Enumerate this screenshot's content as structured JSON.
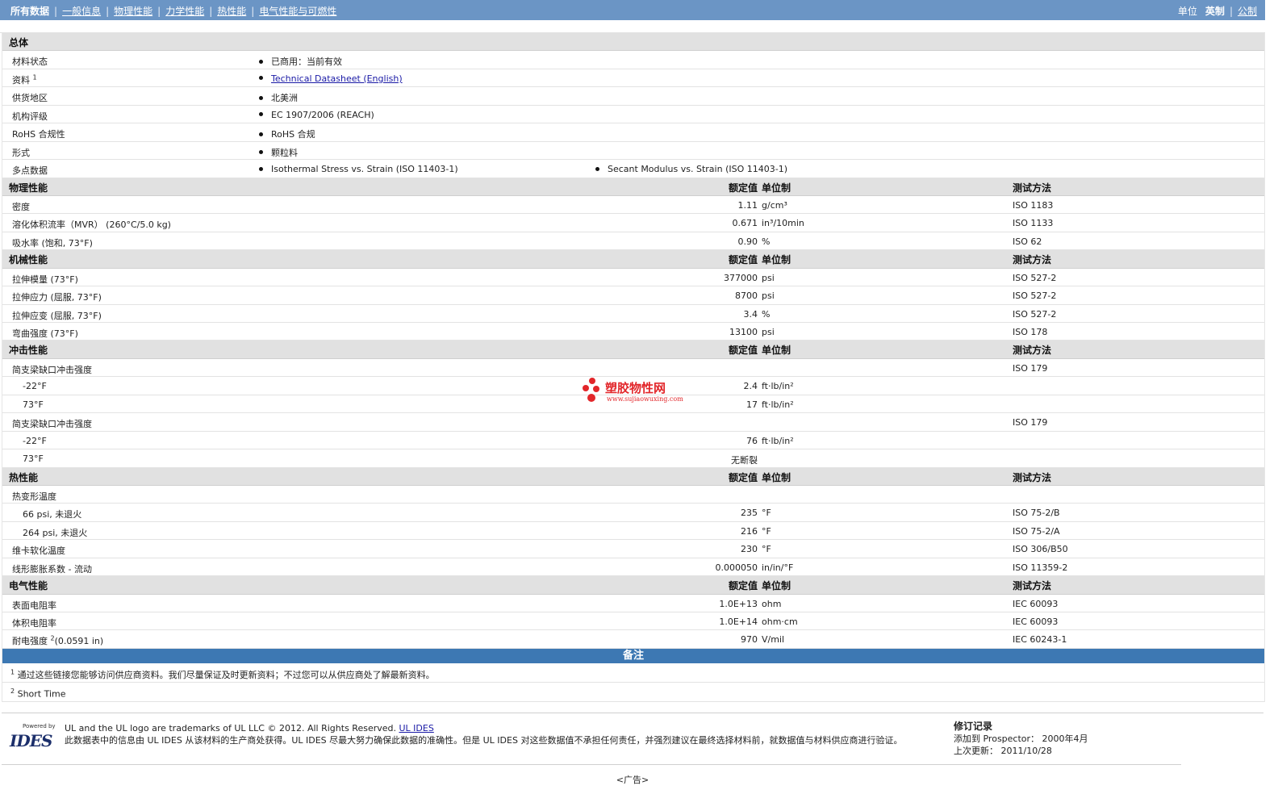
{
  "nav": {
    "items": [
      "所有数据",
      "一般信息",
      "物理性能",
      "力学性能",
      "热性能",
      "电气性能与可燃性"
    ],
    "unit_label": "单位",
    "unit_english": "英制",
    "unit_metric": "公制"
  },
  "general": {
    "title": "总体",
    "rows": [
      {
        "label": "材料状态",
        "values": [
          "已商用：当前有效"
        ]
      },
      {
        "label": "资料",
        "sup": "1",
        "values": [
          "Technical Datasheet (English)"
        ]
      },
      {
        "label": "供货地区",
        "values": [
          "北美洲"
        ]
      },
      {
        "label": "机构评级",
        "values": [
          "EC 1907/2006 (REACH)"
        ]
      },
      {
        "label": "RoHS 合规性",
        "values": [
          "RoHS 合规"
        ]
      },
      {
        "label": "形式",
        "values": [
          "颗粒料"
        ]
      },
      {
        "label": "多点数据",
        "values": [
          "Isothermal Stress vs. Strain (ISO 11403-1)",
          "Secant Modulus vs. Strain (ISO 11403-1)"
        ]
      }
    ]
  },
  "headers": {
    "value": "额定值",
    "unit": "单位制",
    "method": "测试方法"
  },
  "physical": {
    "title": "物理性能",
    "rows": [
      {
        "label": "密度",
        "value": "1.11",
        "unit": "g/cm³",
        "method": "ISO 1183"
      },
      {
        "label": "溶化体积流率（MVR） (260°C/5.0 kg)",
        "value": "0.671",
        "unit": "in³/10min",
        "method": "ISO 1133"
      },
      {
        "label": "吸水率 (饱和, 73°F)",
        "value": "0.90",
        "unit": "%",
        "method": "ISO 62"
      }
    ]
  },
  "mechanical": {
    "title": "机械性能",
    "rows": [
      {
        "label": "拉伸模量 (73°F)",
        "value": "377000",
        "unit": "psi",
        "method": "ISO 527-2"
      },
      {
        "label": "拉伸应力 (屈服, 73°F)",
        "value": "8700",
        "unit": "psi",
        "method": "ISO 527-2"
      },
      {
        "label": "拉伸应变 (屈服, 73°F)",
        "value": "3.4",
        "unit": "%",
        "method": "ISO 527-2"
      },
      {
        "label": "弯曲强度 (73°F)",
        "value": "13100",
        "unit": "psi",
        "method": "ISO 178"
      }
    ]
  },
  "impact": {
    "title": "冲击性能",
    "rows": [
      {
        "label": "简支梁缺口冲击强度",
        "value": "",
        "unit": "",
        "method": "ISO 179"
      },
      {
        "label": "-22°F",
        "value": "2.4",
        "unit": "ft·lb/in²",
        "method": ""
      },
      {
        "label": "73°F",
        "value": "17",
        "unit": "ft·lb/in²",
        "method": ""
      },
      {
        "label": "简支梁缺口冲击强度",
        "value": "",
        "unit": "",
        "method": "ISO 179"
      },
      {
        "label": "-22°F",
        "value": "76",
        "unit": "ft·lb/in²",
        "method": ""
      },
      {
        "label": "73°F",
        "value": "无断裂",
        "unit": "",
        "method": ""
      }
    ]
  },
  "thermal": {
    "title": "热性能",
    "rows": [
      {
        "label": "热变形温度",
        "value": "",
        "unit": "",
        "method": ""
      },
      {
        "label": "66 psi, 未退火",
        "value": "235",
        "unit": "°F",
        "method": "ISO 75-2/B"
      },
      {
        "label": "264 psi, 未退火",
        "value": "216",
        "unit": "°F",
        "method": "ISO 75-2/A"
      },
      {
        "label": "维卡软化温度",
        "value": "230",
        "unit": "°F",
        "method": "ISO 306/B50"
      },
      {
        "label": "线形膨胀系数 - 流动",
        "value": "0.000050",
        "unit": "in/in/°F",
        "method": "ISO 11359-2"
      }
    ]
  },
  "electrical": {
    "title": "电气性能",
    "rows": [
      {
        "label": "表面电阻率",
        "value": "1.0E+13",
        "unit": "ohm",
        "method": "IEC 60093"
      },
      {
        "label": "体积电阻率",
        "value": "1.0E+14",
        "unit": "ohm·cm",
        "method": "IEC 60093"
      },
      {
        "label": "耐电强度",
        "sup": "2",
        "label_suffix": "(0.0591 in)",
        "value": "970",
        "unit": "V/mil",
        "method": "IEC 60243-1"
      }
    ]
  },
  "notes": {
    "title": "备注",
    "items": [
      {
        "num": "1",
        "text": "通过这些链接您能够访问供应商资料。我们尽量保证及时更新资料；不过您可以从供应商处了解最新资料。"
      },
      {
        "num": "2",
        "text": "Short Time"
      }
    ]
  },
  "watermark": {
    "text": "塑胶物性网",
    "url": "www.sujiaowuxing.com"
  },
  "footer": {
    "logo_powered": "Powered by",
    "logo_name": "IDES",
    "trademark": "UL and the UL logo are trademarks of UL LLC © 2012. All Rights Reserved.",
    "trademark_link": "UL IDES",
    "disclaimer": "此数据表中的信息由 UL IDES 从该材料的生产商处获得。UL IDES 尽最大努力确保此数据的准确性。但是 UL IDES 对这些数据值不承担任何责任，并强烈建议在最终选择材料前，就数据值与材料供应商进行验证。",
    "revision_title": "修订记录",
    "added_label": "添加到 Prospector：",
    "added_value": "2000年4月",
    "updated_label": "上次更新：",
    "updated_value": "2011/10/28"
  },
  "ad": "<广告>"
}
